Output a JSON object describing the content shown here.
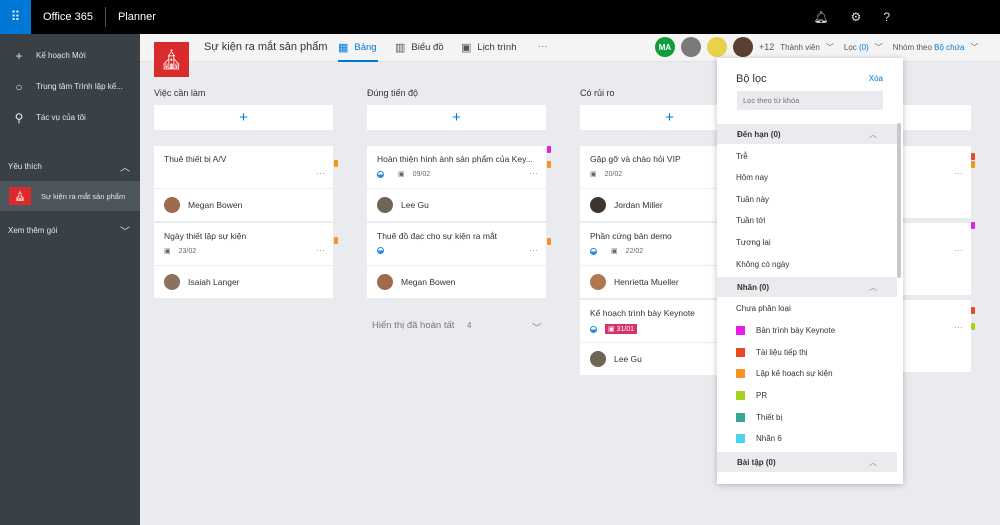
{
  "topbar": {
    "suite": "Office 365",
    "app": "Planner",
    "icons": [
      "bell-icon",
      "gear-icon",
      "help-icon"
    ],
    "help_glyph": "?"
  },
  "sidebar": {
    "items": [
      {
        "icon": "plus-icon",
        "glyph": "+",
        "label": "Kế hoạch Mới"
      },
      {
        "icon": "hub-icon",
        "glyph": "○",
        "label": "Trung tâm Trình lập kế..."
      },
      {
        "icon": "person-icon",
        "glyph": "⚲",
        "label": "Tác vụ của tôi"
      }
    ],
    "favorites_label": "Yêu thích",
    "favorite_plan": "Sự kiện ra mắt sản phẩm",
    "more_plans_label": "Xem thêm gói"
  },
  "header": {
    "plan_title": "Sự kiện ra mắt sản phẩm",
    "tabs": [
      {
        "label": "Bảng",
        "active": true
      },
      {
        "label": "Biểu đồ",
        "active": false
      },
      {
        "label": "Lịch trình",
        "active": false
      }
    ],
    "more": "···",
    "avatar_initials": "MA",
    "member_count": "+12",
    "members_label": "Thành viên",
    "filter_label": "Lọc",
    "filter_count": "(0)",
    "group_by_label": "Nhóm theo",
    "group_by_value": "Bộ chứa"
  },
  "colors": {
    "accent": "#0078d7",
    "sidebar": "#394146",
    "brand_red": "#d92b2b",
    "late": "#d6336c"
  },
  "buckets": [
    {
      "title": "Việc cần làm",
      "tasks": [
        {
          "title": "Thuê thiết bị A/V",
          "date": "",
          "assignee": "Megan Bowen"
        },
        {
          "title": "Ngày thiết lập sự kiện",
          "date": "23/02",
          "assignee": "Isaiah Langer"
        }
      ]
    },
    {
      "title": "Đúng tiến độ",
      "tasks": [
        {
          "title": "Hoàn thiện hình ảnh sản phẩm của Key...",
          "date": "09/02",
          "assignee": "Lee Gu"
        },
        {
          "title": "Thuê đồ đạc cho sự kiện ra mắt",
          "date": "",
          "assignee": "Megan Bowen"
        }
      ],
      "show_completed": "Hiển thị đã hoàn tất",
      "completed_count": "4"
    },
    {
      "title": "Có rủi ro",
      "tasks": [
        {
          "title": "Gặp gỡ và chào hỏi VIP",
          "date": "20/02",
          "assignee": "Jordan Miller"
        },
        {
          "title": "Phần cứng bản demo",
          "date": "22/02",
          "assignee": "Henrietta Mueller"
        },
        {
          "title": "Kế hoạch trình bày Keynote",
          "date": "31/01",
          "assignee": "Lee Gu"
        }
      ]
    }
  ],
  "filter_panel": {
    "title": "Bộ lọc",
    "clear": "Xóa",
    "search_placeholder": "Lọc theo từ khóa",
    "due_group": "Đến hạn (0)",
    "due_options": [
      "Trễ",
      "Hôm nay",
      "Tuần này",
      "Tuần tới",
      "Tương lai",
      "Không có ngày"
    ],
    "label_group": "Nhãn (0)",
    "uncategorized": "Chưa phân loại",
    "labels": [
      {
        "name": "Bản trình bày Keynote",
        "color": "#e81ce8"
      },
      {
        "name": "Tài liệu tiếp thị",
        "color": "#ea4a1f"
      },
      {
        "name": "Lập kế hoạch sự kiện",
        "color": "#f7941d"
      },
      {
        "name": "PR",
        "color": "#a4d21c"
      },
      {
        "name": "Thiết bị",
        "color": "#3aa694"
      },
      {
        "name": "Nhãn 6",
        "color": "#4cd3f0"
      }
    ],
    "assign_group": "Bài tập (0)"
  }
}
